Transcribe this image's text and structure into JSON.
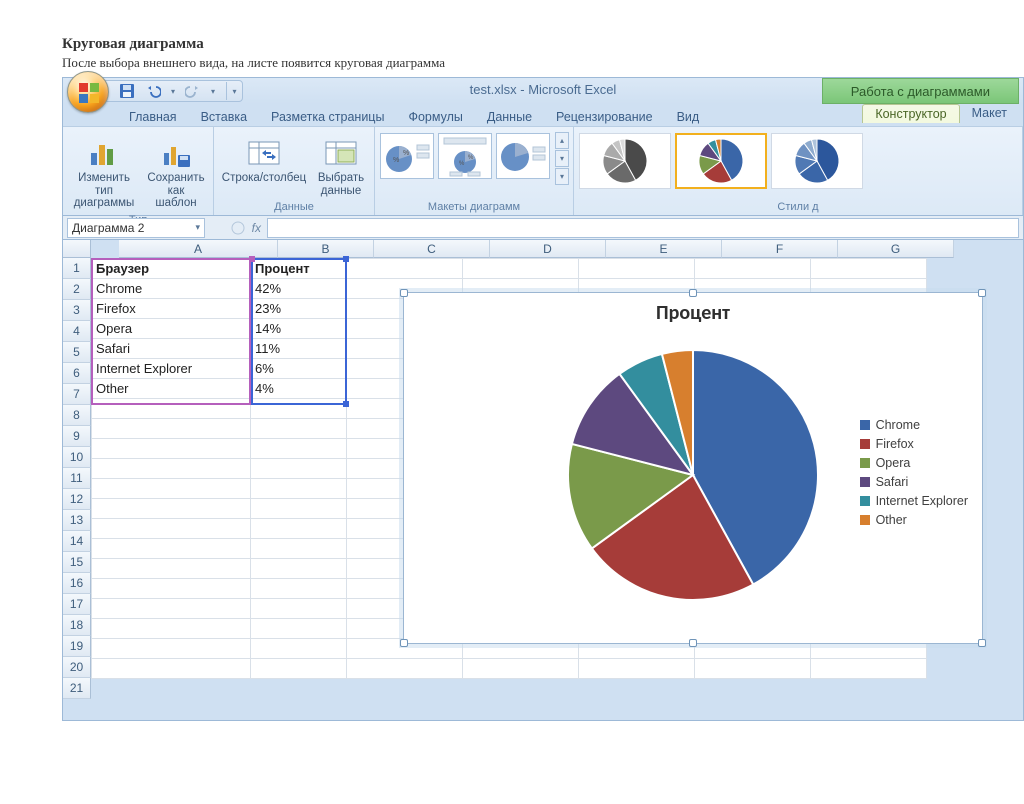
{
  "page": {
    "heading": "Круговая диаграмма",
    "subtext": "После выбора внешнего вида, на листе появится круговая диаграмма"
  },
  "titlebar": {
    "filename": "test.xlsx",
    "app": "Microsoft Excel",
    "chart_tools": "Работа с диаграммами"
  },
  "tabs": {
    "home": "Главная",
    "insert": "Вставка",
    "page_layout": "Разметка страницы",
    "formulas": "Формулы",
    "data": "Данные",
    "review": "Рецензирование",
    "view": "Вид",
    "design": "Конструктор",
    "layout": "Макет"
  },
  "ribbon": {
    "change_chart_type": "Изменить тип диаграммы",
    "save_as_template": "Сохранить как шаблон",
    "group_type": "Тип",
    "switch_row_col": "Строка/столбец",
    "select_data": "Выбрать данные",
    "group_data": "Данные",
    "group_layouts": "Макеты диаграмм",
    "group_styles": "Стили д"
  },
  "namebox": "Диаграмма 2",
  "columns": [
    "A",
    "B",
    "C",
    "D",
    "E",
    "F",
    "G"
  ],
  "rows": [
    "1",
    "2",
    "3",
    "4",
    "5",
    "6",
    "7",
    "8",
    "9",
    "10",
    "11",
    "12",
    "13",
    "14",
    "15",
    "16",
    "17",
    "18",
    "19",
    "20",
    "21"
  ],
  "table": {
    "headers": {
      "a": "Браузер",
      "b": "Процент"
    },
    "rows": [
      {
        "a": "Chrome",
        "b": "42%"
      },
      {
        "a": "Firefox",
        "b": "23%"
      },
      {
        "a": "Opera",
        "b": "14%"
      },
      {
        "a": "Safari",
        "b": "11%"
      },
      {
        "a": "Internet Explorer",
        "b": "6%"
      },
      {
        "a": "Other",
        "b": "4%"
      }
    ]
  },
  "chart": {
    "title": "Процент"
  },
  "chart_data": {
    "type": "pie",
    "title": "Процент",
    "categories": [
      "Chrome",
      "Firefox",
      "Opera",
      "Safari",
      "Internet Explorer",
      "Other"
    ],
    "values": [
      42,
      23,
      14,
      11,
      6,
      4
    ],
    "colors": [
      "#3a66a8",
      "#a63c39",
      "#7a9a4a",
      "#5d497f",
      "#338e9e",
      "#d77f2e"
    ]
  }
}
